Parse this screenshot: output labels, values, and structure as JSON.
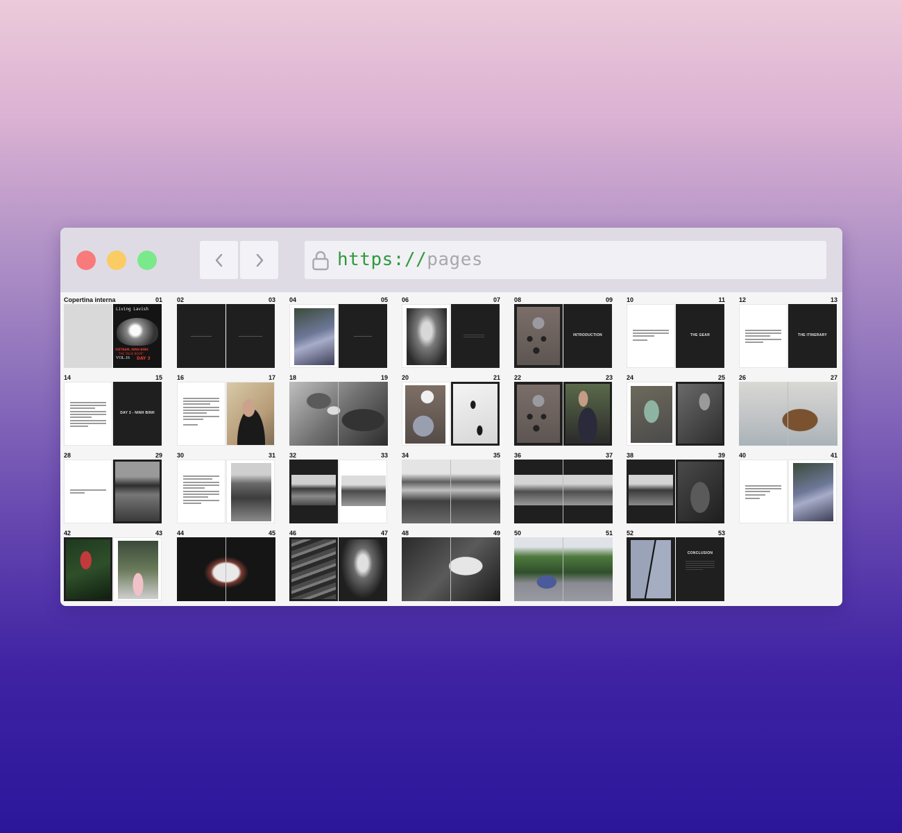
{
  "browser": {
    "url_scheme": "https://",
    "url_path": "pages",
    "back_icon": "chevron-left-icon",
    "forward_icon": "chevron-right-icon",
    "lock_icon": "lock-icon",
    "colors": {
      "close": "#f87a7a",
      "minimize": "#fbcb64",
      "maximize": "#7ae98c",
      "scheme": "#2e9a3c"
    }
  },
  "spreads": [
    {
      "left": "Copertina interna",
      "right": "01"
    },
    {
      "left": "02",
      "right": "03"
    },
    {
      "left": "04",
      "right": "05"
    },
    {
      "left": "06",
      "right": "07"
    },
    {
      "left": "08",
      "right": "09"
    },
    {
      "left": "10",
      "right": "11"
    },
    {
      "left": "12",
      "right": "13"
    },
    {
      "left": "14",
      "right": "15"
    },
    {
      "left": "16",
      "right": "17"
    },
    {
      "left": "18",
      "right": "19"
    },
    {
      "left": "20",
      "right": "21"
    },
    {
      "left": "22",
      "right": "23"
    },
    {
      "left": "24",
      "right": "25"
    },
    {
      "left": "26",
      "right": "27"
    },
    {
      "left": "28",
      "right": "29"
    },
    {
      "left": "30",
      "right": "31"
    },
    {
      "left": "32",
      "right": "33"
    },
    {
      "left": "34",
      "right": "35"
    },
    {
      "left": "36",
      "right": "37"
    },
    {
      "left": "38",
      "right": "39"
    },
    {
      "left": "40",
      "right": "41"
    },
    {
      "left": "42",
      "right": "43"
    },
    {
      "left": "44",
      "right": "45"
    },
    {
      "left": "46",
      "right": "47"
    },
    {
      "left": "48",
      "right": "49"
    },
    {
      "left": "50",
      "right": "51"
    },
    {
      "left": "52",
      "right": "53"
    }
  ],
  "page_titles": {
    "cover_line1": "Living Lavish",
    "cover_line2": "VIETNAM, NINH BINH",
    "cover_line3": "THE \"BLUE BOOK\"",
    "cover_vol": "VOL.16",
    "cover_day": "DAY 3",
    "p09": "INTRODUCTION",
    "p11": "THE GEAR",
    "p13": "THE ITINERARY",
    "p15": "DAY 3 - NINH BINH",
    "p53": "CONCLUSION"
  }
}
